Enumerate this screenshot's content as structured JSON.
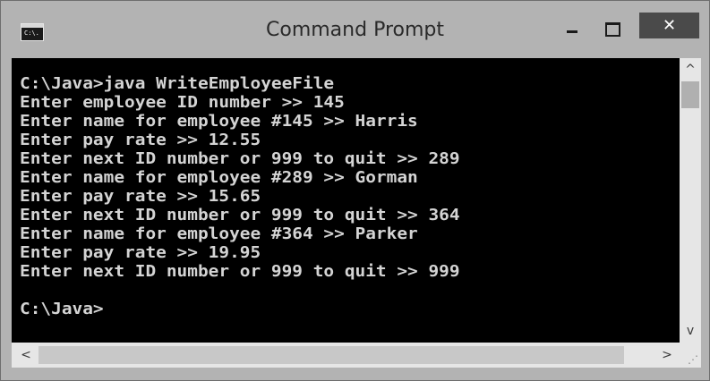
{
  "window": {
    "title": "Command Prompt",
    "icon_label": "C:\\.",
    "buttons": {
      "minimize": "minimize-icon",
      "maximize": "maximize-icon",
      "close_glyph": "✕"
    }
  },
  "console": {
    "lines": [
      "C:\\Java>java WriteEmployeeFile",
      "Enter employee ID number >> 145",
      "Enter name for employee #145 >> Harris",
      "Enter pay rate >> 12.55",
      "Enter next ID number or 999 to quit >> 289",
      "Enter name for employee #289 >> Gorman",
      "Enter pay rate >> 15.65",
      "Enter next ID number or 999 to quit >> 364",
      "Enter name for employee #364 >> Parker",
      "Enter pay rate >> 19.95",
      "Enter next ID number or 999 to quit >> 999",
      "",
      "C:\\Java>"
    ]
  },
  "scrollbars": {
    "up_glyph": "^",
    "down_glyph": "v",
    "left_glyph": "<",
    "right_glyph": ">"
  },
  "colors": {
    "console_bg": "#000000",
    "console_text": "#d4d4d4",
    "chrome": "#b3b3b3",
    "close_button": "#4a4a4a"
  }
}
